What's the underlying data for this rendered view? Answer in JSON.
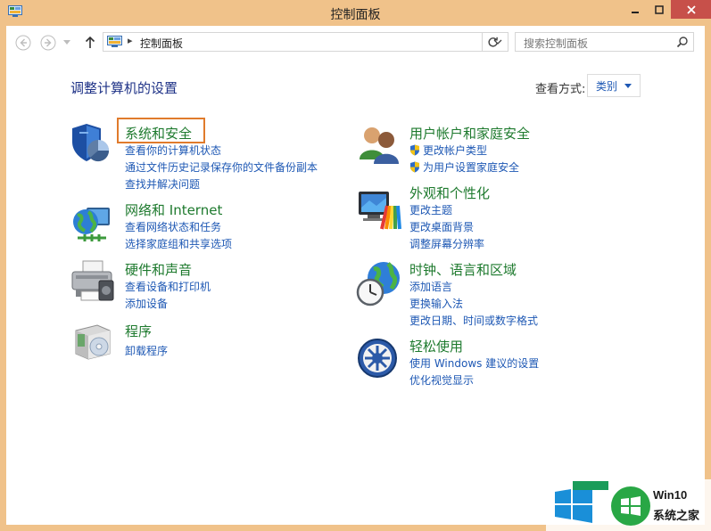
{
  "window": {
    "title": "控制面板"
  },
  "address": {
    "crumb": "控制面板"
  },
  "search": {
    "placeholder": "搜索控制面板"
  },
  "main": {
    "heading": "调整计算机的设置",
    "view_by_label": "查看方式:",
    "view_by_value": "类别"
  },
  "categories": [
    {
      "title": "系统和安全",
      "icon": "shield-pie-icon",
      "links": [
        "查看你的计算机状态",
        "通过文件历史记录保存你的文件备份副本",
        "查找并解决问题"
      ]
    },
    {
      "title": "网络和 Internet",
      "icon": "globe-network-icon",
      "links": [
        "查看网络状态和任务",
        "选择家庭组和共享选项"
      ]
    },
    {
      "title": "硬件和声音",
      "icon": "printer-icon",
      "links": [
        "查看设备和打印机",
        "添加设备"
      ]
    },
    {
      "title": "程序",
      "icon": "programs-box-icon",
      "links": [
        "卸载程序"
      ]
    },
    {
      "title": "用户帐户和家庭安全",
      "icon": "users-icon",
      "links": [
        "更改帐户类型",
        "为用户设置家庭安全"
      ]
    },
    {
      "title": "外观和个性化",
      "icon": "monitor-palette-icon",
      "links": [
        "更改主题",
        "更改桌面背景",
        "调整屏幕分辨率"
      ]
    },
    {
      "title": "时钟、语言和区域",
      "icon": "clock-globe-icon",
      "links": [
        "添加语言",
        "更换输入法",
        "更改日期、时间或数字格式"
      ]
    },
    {
      "title": "轻松使用",
      "icon": "ease-of-access-icon",
      "links": [
        "使用 Windows 建议的设置",
        "优化视觉显示"
      ]
    }
  ],
  "watermark": {
    "line1": "Win10",
    "line2": "系统之家"
  },
  "colors": {
    "titlebar": "#f0c28a",
    "close": "#c7504a",
    "category_title": "#1e7a2e",
    "link": "#1e58b4",
    "heading": "#1e3287",
    "highlight": "#e07b2c"
  }
}
